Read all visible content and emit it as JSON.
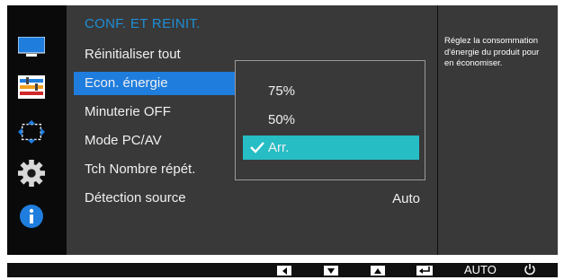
{
  "menu": {
    "title": "CONF. ET REINIT.",
    "items": [
      {
        "label": "Réinitialiser tout"
      },
      {
        "label": "Econ. énergie",
        "active": true
      },
      {
        "label": "Minuterie OFF"
      },
      {
        "label": "Mode PC/AV"
      },
      {
        "label": "Tch Nombre répét."
      },
      {
        "label": "Détection source",
        "value": "Auto"
      }
    ]
  },
  "submenu": {
    "options": [
      {
        "label": "75%"
      },
      {
        "label": "50%"
      },
      {
        "label": "Arr.",
        "selected": true
      }
    ]
  },
  "info": {
    "lines": [
      "Réglez la consommation",
      "d'énergie du produit pour",
      "en économiser."
    ]
  },
  "sidebar": {
    "icons": [
      "monitor-icon",
      "color-settings-icon",
      "size-position-icon",
      "setup-gear-icon",
      "information-icon"
    ]
  },
  "bottom_bar": {
    "buttons": [
      "left-arrow-button",
      "down-arrow-button",
      "up-arrow-button",
      "enter-button"
    ],
    "auto_label": "AUTO"
  },
  "colors": {
    "accent_blue": "#1f7dde",
    "title_blue": "#1e8fd8",
    "selected_teal": "#26bdc5",
    "panel": "#393939"
  }
}
